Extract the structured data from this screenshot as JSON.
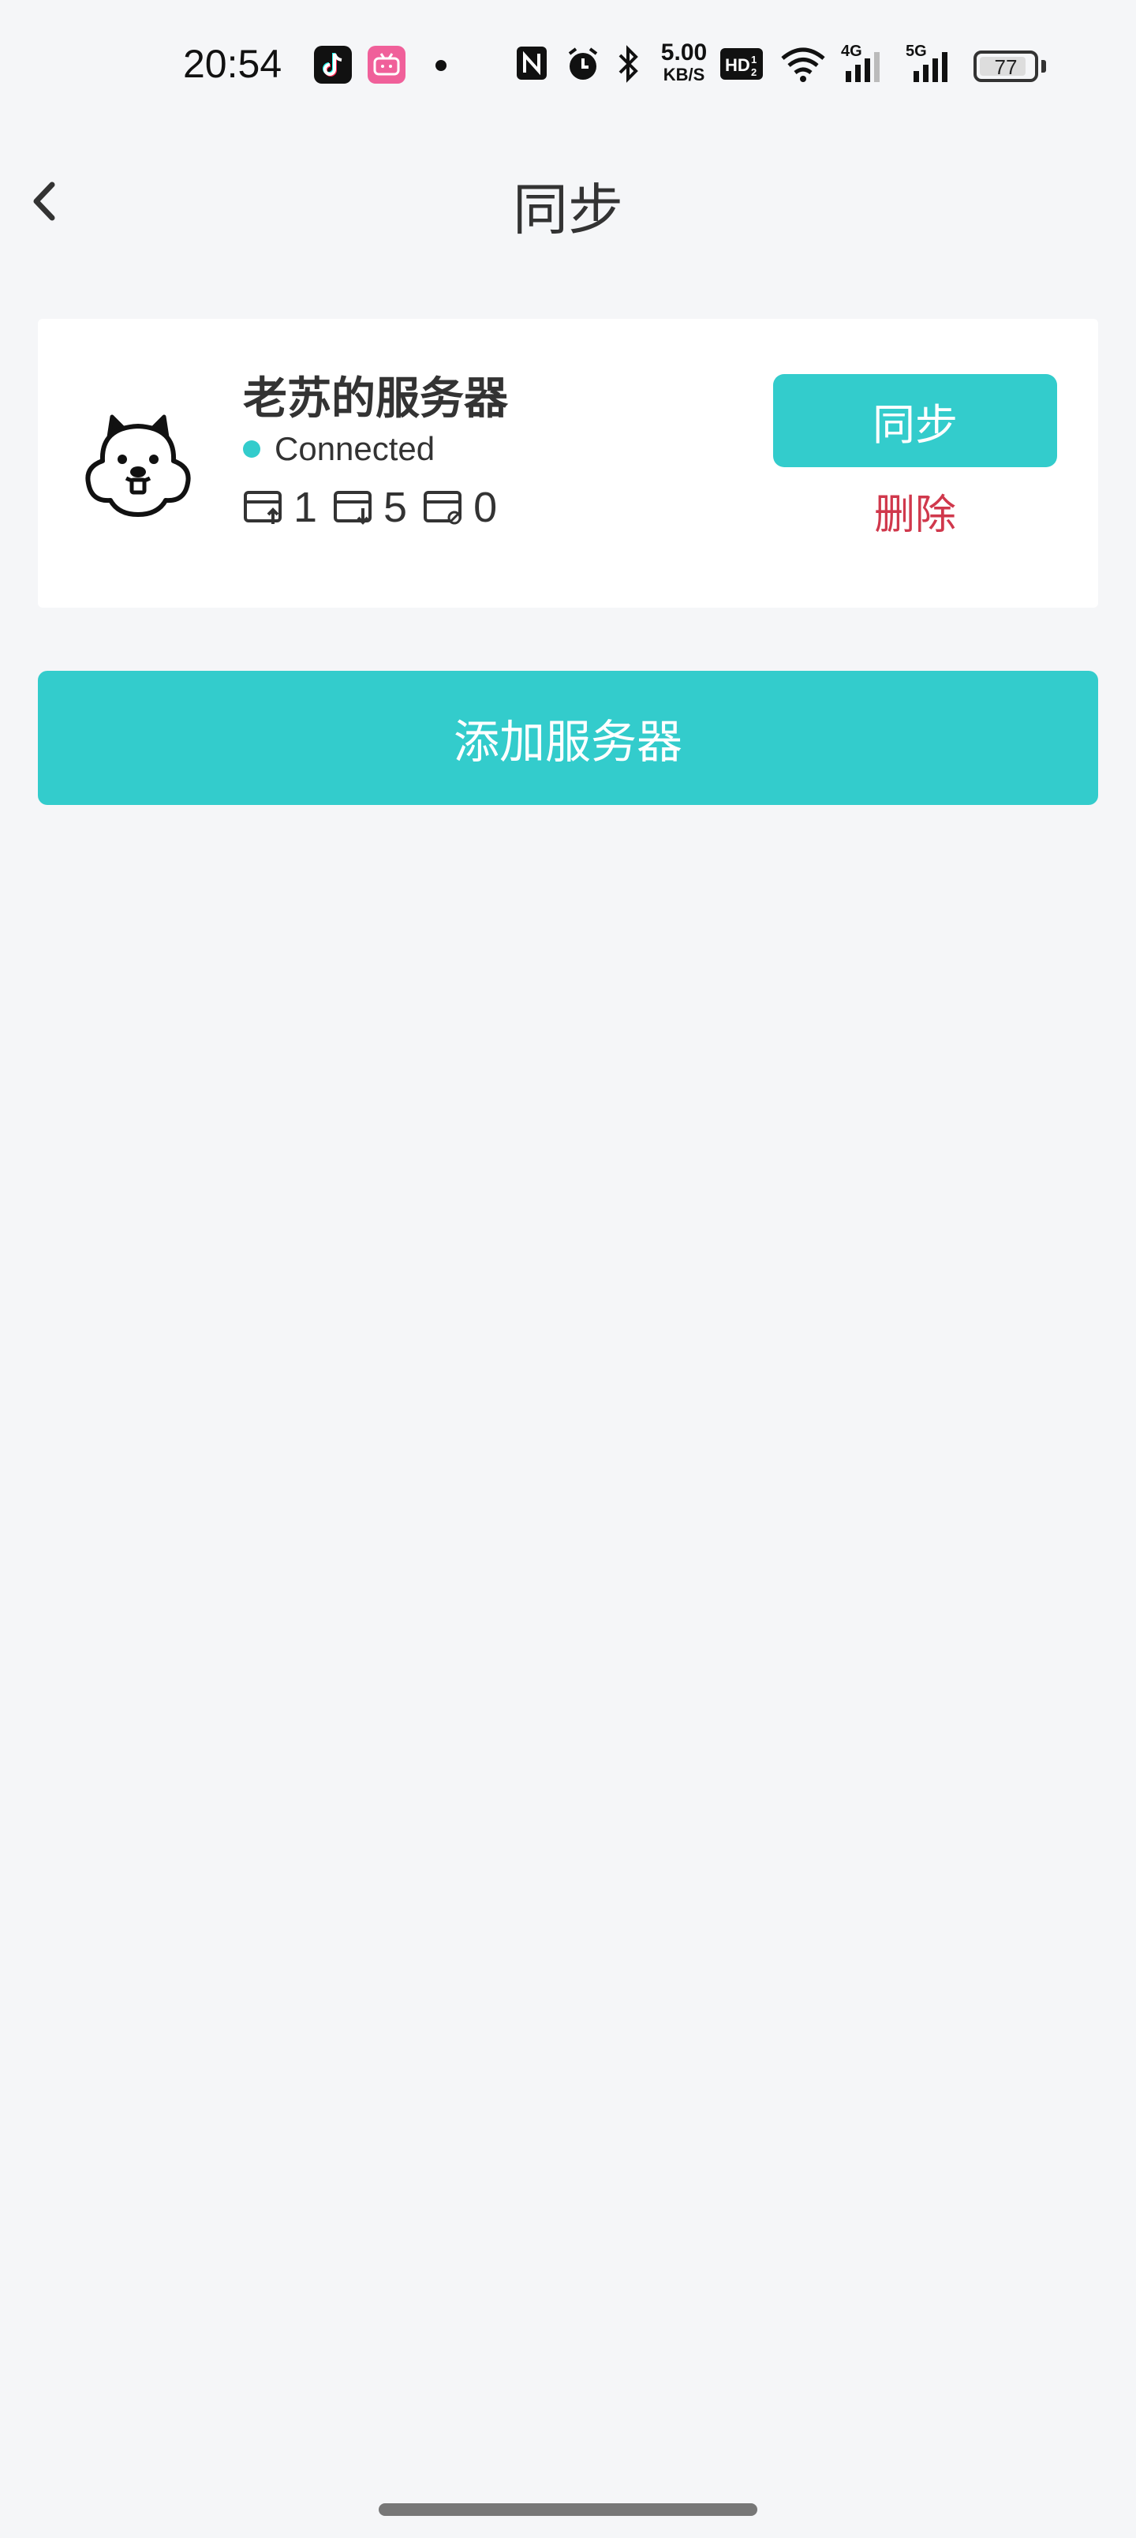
{
  "status_bar": {
    "time": "20:54",
    "apps": [
      "tiktok-icon",
      "bilibili-icon"
    ],
    "net_speed_value": "5.00",
    "net_speed_unit": "KB/S",
    "hd_label": "HD",
    "network_4g": "4G",
    "network_5g": "5G",
    "battery": "77"
  },
  "header": {
    "title": "同步",
    "back_icon": "chevron-left-icon"
  },
  "server": {
    "name": "老苏的服务器",
    "status": "Connected",
    "status_color": "#33cccc",
    "upload_count": "1",
    "download_count": "5",
    "conflict_count": "0",
    "sync_label": "同步",
    "delete_label": "删除",
    "avatar_icon": "beaver-icon"
  },
  "actions": {
    "add_server_label": "添加服务器"
  },
  "colors": {
    "accent": "#33cccc",
    "danger": "#d0384c",
    "background": "#f5f6f8"
  }
}
